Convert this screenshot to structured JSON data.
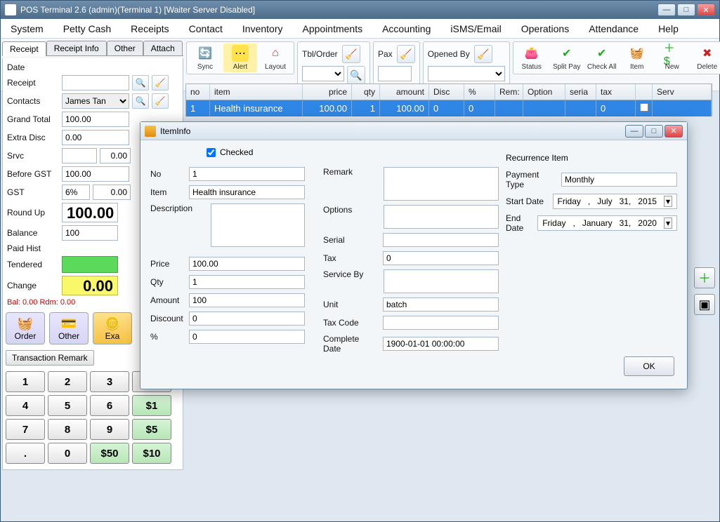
{
  "window": {
    "title": "POS Terminal 2.6 (admin)(Terminal 1) [Waiter Server Disabled]"
  },
  "menus": [
    "System",
    "Petty Cash",
    "Receipts",
    "Contact",
    "Inventory",
    "Appointments",
    "Accounting",
    "iSMS/Email",
    "Operations",
    "Attendance",
    "Help"
  ],
  "toolbar": {
    "sync": "Sync",
    "alert": "Alert",
    "layout": "Layout",
    "tblorder": "Tbl/Order",
    "pax": "Pax",
    "openedby": "Opened By",
    "status": "Status",
    "splitpay": "Split Pay",
    "checkall": "Check All",
    "item": "Item",
    "new": "New",
    "delete": "Delete"
  },
  "tabs": [
    "Receipt",
    "Receipt Info",
    "Other",
    "Attach"
  ],
  "receipt": {
    "date_label": "Date",
    "receipt_label": "Receipt",
    "contacts_label": "Contacts",
    "contacts_value": "James Tan",
    "grandtotal_label": "Grand Total",
    "grandtotal_value": "100.00",
    "extradisc_label": "Extra Disc",
    "extradisc_value": "0.00",
    "srvc_label": "Srvc",
    "srvc_value": "0.00",
    "beforegst_label": "Before GST",
    "beforegst_value": "100.00",
    "gst_label": "GST",
    "gst_pct": "6%",
    "gst_value": "0.00",
    "roundup_label": "Round Up",
    "roundup_value": "100.00",
    "balance_label": "Balance",
    "balance_value": "100",
    "paidhist_label": "Paid Hist",
    "tendered_label": "Tendered",
    "change_label": "Change",
    "change_value": "0.00",
    "balnote": "Bal: 0.00 Rdm: 0.00"
  },
  "bigbuttons": {
    "order": "Order",
    "other": "Other",
    "exact": "Exa"
  },
  "txnremark": "Transaction Remark",
  "keypad": {
    "k1": "1",
    "k2": "2",
    "k3": "3",
    "back": "⇦",
    "k4": "4",
    "k5": "5",
    "k6": "6",
    "d1": "$1",
    "k7": "7",
    "k8": "8",
    "k9": "9",
    "d5": "$5",
    "kdot": ".",
    "k0": "0",
    "d50": "$50",
    "d10": "$10"
  },
  "gridheaders": {
    "no": "no",
    "item": "item",
    "price": "price",
    "qty": "qty",
    "amount": "amount",
    "disc": "Disc",
    "pct": "%",
    "rem": "Rem:",
    "option": "Option",
    "seria": "seria",
    "tax": "tax",
    "serv": "Serv"
  },
  "gridrow": {
    "no": "1",
    "item": "Health insurance",
    "price": "100.00",
    "qty": "1",
    "amount": "100.00",
    "disc": "0",
    "pct": "0",
    "tax": "0"
  },
  "modal": {
    "title": "ItemInfo",
    "checked_label": "Checked",
    "no_label": "No",
    "no_value": "1",
    "item_label": "Item",
    "item_value": "Health insurance",
    "desc_label": "Description",
    "price_label": "Price",
    "price_value": "100.00",
    "qty_label": "Qty",
    "qty_value": "1",
    "amount_label": "Amount",
    "amount_value": "100",
    "discount_label": "Discount",
    "discount_value": "0",
    "pct_label": "%",
    "pct_value": "0",
    "remark_label": "Remark",
    "options_label": "Options",
    "serial_label": "Serial",
    "tax_label": "Tax",
    "tax_value": "0",
    "serviceby_label": "Service By",
    "unit_label": "Unit",
    "unit_value": "batch",
    "taxcode_label": "Tax Code",
    "completedate_label": "Complete Date",
    "completedate_value": "1900-01-01 00:00:00",
    "recurrence_label": "Recurrence Item",
    "paytype_label": "Payment Type",
    "paytype_value": "Monthly",
    "start_label": "Start Date",
    "start_value": {
      "dow": "Friday",
      "month": "July",
      "day": "31,",
      "year": "2015"
    },
    "end_label": "End Date",
    "end_value": {
      "dow": "Friday",
      "month": "January",
      "day": "31,",
      "year": "2020"
    },
    "ok": "OK"
  }
}
